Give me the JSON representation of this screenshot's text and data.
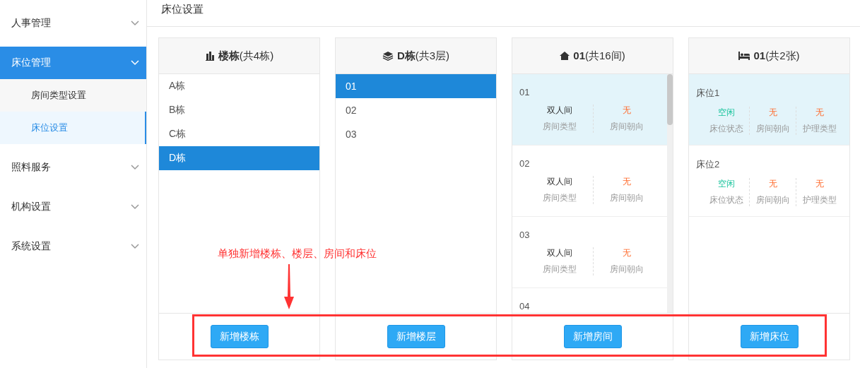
{
  "sidebar": {
    "items": [
      {
        "label": "人事管理",
        "selected": false
      },
      {
        "label": "床位管理",
        "selected": true,
        "children": [
          {
            "label": "房间类型设置",
            "selected": false
          },
          {
            "label": "床位设置",
            "selected": true
          }
        ]
      },
      {
        "label": "照料服务",
        "selected": false
      },
      {
        "label": "机构设置",
        "selected": false
      },
      {
        "label": "系统设置",
        "selected": false
      }
    ]
  },
  "page_title": "床位设置",
  "panels": [
    {
      "kind": "list",
      "title": "楼栋",
      "count": "(共4栋)",
      "items": [
        {
          "label": "A栋",
          "selected": false
        },
        {
          "label": "B栋",
          "selected": false
        },
        {
          "label": "C栋",
          "selected": false
        },
        {
          "label": "D栋",
          "selected": true
        }
      ],
      "button": "新增楼栋"
    },
    {
      "kind": "list",
      "title": "D栋",
      "count": "(共3层)",
      "items": [
        {
          "label": "01",
          "selected": true
        },
        {
          "label": "02",
          "selected": false
        },
        {
          "label": "03",
          "selected": false
        }
      ],
      "button": "新增楼层"
    },
    {
      "kind": "cards",
      "title": "01",
      "count": "(共16间)",
      "cards": [
        {
          "name": "01",
          "selected": true,
          "fields": [
            {
              "value": "双人间",
              "label": "房间类型",
              "kind": "plain"
            },
            {
              "value": "无",
              "label": "房间朝向",
              "kind": "none"
            }
          ]
        },
        {
          "name": "02",
          "selected": false,
          "fields": [
            {
              "value": "双人间",
              "label": "房间类型",
              "kind": "plain"
            },
            {
              "value": "无",
              "label": "房间朝向",
              "kind": "none"
            }
          ]
        },
        {
          "name": "03",
          "selected": false,
          "fields": [
            {
              "value": "双人间",
              "label": "房间类型",
              "kind": "plain"
            },
            {
              "value": "无",
              "label": "房间朝向",
              "kind": "none"
            }
          ]
        },
        {
          "name": "04",
          "selected": false
        }
      ],
      "button": "新增房间"
    },
    {
      "kind": "cards",
      "title": "01",
      "count": "(共2张)",
      "cards": [
        {
          "name": "床位1",
          "selected": true,
          "fields": [
            {
              "value": "空闲",
              "label": "床位状态",
              "kind": "free"
            },
            {
              "value": "无",
              "label": "房间朝向",
              "kind": "none"
            },
            {
              "value": "无",
              "label": "护理类型",
              "kind": "none"
            }
          ]
        },
        {
          "name": "床位2",
          "selected": false,
          "fields": [
            {
              "value": "空闲",
              "label": "床位状态",
              "kind": "free"
            },
            {
              "value": "无",
              "label": "房间朝向",
              "kind": "none"
            },
            {
              "value": "无",
              "label": "护理类型",
              "kind": "none"
            }
          ]
        }
      ],
      "button": "新增床位"
    }
  ],
  "annotation": {
    "text": "单独新增楼栋、楼层、房间和床位"
  }
}
